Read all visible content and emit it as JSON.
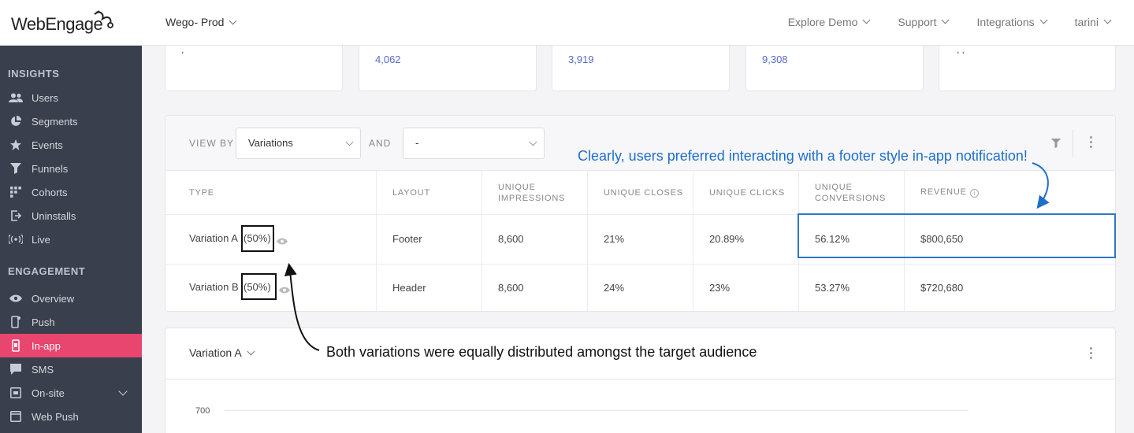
{
  "app": {
    "logo_text": "WebEngage",
    "project": "Wego- Prod"
  },
  "topnav": [
    "Explore Demo",
    "Support",
    "Integrations",
    "tarini"
  ],
  "sidebar": {
    "insights_title": "INSIGHTS",
    "insights": [
      {
        "label": "Users",
        "icon": "users-icon"
      },
      {
        "label": "Segments",
        "icon": "pie-chart-icon"
      },
      {
        "label": "Events",
        "icon": "star-icon"
      },
      {
        "label": "Funnels",
        "icon": "funnel-icon"
      },
      {
        "label": "Cohorts",
        "icon": "grid-icon"
      },
      {
        "label": "Uninstalls",
        "icon": "exit-icon"
      },
      {
        "label": "Live",
        "icon": "broadcast-icon"
      }
    ],
    "engagement_title": "ENGAGEMENT",
    "engagement": [
      {
        "label": "Overview",
        "icon": "eye-icon"
      },
      {
        "label": "Push",
        "icon": "mobile-icon"
      },
      {
        "label": "In-app",
        "icon": "in-app-icon",
        "active": true
      },
      {
        "label": "SMS",
        "icon": "message-icon"
      },
      {
        "label": "On-site",
        "icon": "onsite-icon",
        "expandable": true
      },
      {
        "label": "Web Push",
        "icon": "web-push-icon"
      }
    ]
  },
  "cards": [
    "4,062",
    "3,919",
    "9,308"
  ],
  "table": {
    "view_by_label": "VIEW BY",
    "view_by_value": "Variations",
    "and_label": "AND",
    "and_value": "-",
    "headers": {
      "type": "TYPE",
      "layout": "LAYOUT",
      "impressions": "UNIQUE IMPRESSIONS",
      "closes": "UNIQUE CLOSES",
      "clicks": "UNIQUE CLICKS",
      "conversions": "UNIQUE CONVERSIONS",
      "revenue": "REVENUE"
    },
    "rows": [
      {
        "type": "Variation A",
        "share": "(50%)",
        "layout": "Footer",
        "impressions": "8,600",
        "closes": "21%",
        "clicks": "20.89%",
        "conversions": "56.12%",
        "revenue": "$800,650"
      },
      {
        "type": "Variation B",
        "share": "(50%)",
        "layout": "Header",
        "impressions": "8,600",
        "closes": "24%",
        "clicks": "23%",
        "conversions": "53.27%",
        "revenue": "$720,680"
      }
    ]
  },
  "chart_panel": {
    "variation_select": "Variation A",
    "y_tick": "700"
  },
  "annotations": {
    "top": "Clearly, users preferred interacting with a footer style in-app notification!",
    "bottom": "Both variations were equally distributed amongst the target audience"
  },
  "colors": {
    "accent": "#e8456f",
    "sidebar_bg": "#3a3f4d",
    "link": "#5b6ac8",
    "annotation_blue": "#1f6fc9"
  }
}
